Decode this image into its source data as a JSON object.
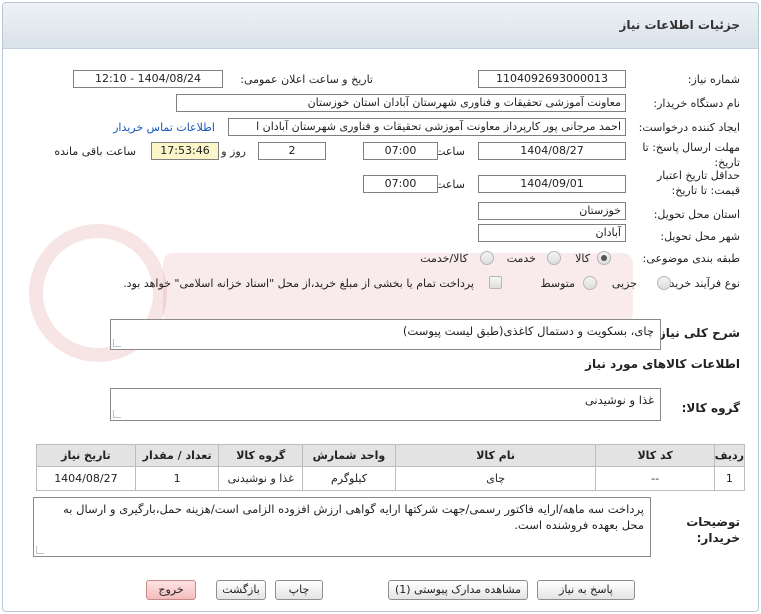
{
  "header": {
    "title": "جزئیات اطلاعات نیاز"
  },
  "fields": {
    "need_number_label": "شماره نیاز:",
    "need_number": "1104092693000013",
    "announce_label": "تاریخ و ساعت اعلان عمومی:",
    "announce_value": "1404/08/24 - 12:10",
    "buyer_org_label": "نام دستگاه خریدار:",
    "buyer_org": "معاونت آموزشی  تحقیقات و فناوری شهرستان آبادان استان خوزستان",
    "requester_label": "ایجاد کننده درخواست:",
    "requester": "احمد  مرجانی پور کارپرداز معاونت آموزشی  تحقیقات و فناوری شهرستان آبادان ا",
    "contact_link": "اطلاعات تماس خریدار",
    "deadline_label": "مهلت ارسال پاسخ: تا تاریخ:",
    "deadline_date": "1404/08/27",
    "time_label": "ساعت",
    "deadline_time": "07:00",
    "days_value": "2",
    "days_label": "روز و",
    "remaining_time": "17:53:46",
    "remaining_label": "ساعت باقی مانده",
    "validity_label": "حداقل تاریخ اعتبار قیمت: تا تاریخ:",
    "validity_date": "1404/09/01",
    "validity_time": "07:00",
    "province_label": "استان محل تحویل:",
    "province": "خوزستان",
    "city_label": "شهر محل تحویل:",
    "city": "آبادان",
    "category_label": "طبقه بندی موضوعی:",
    "category_options": [
      "کالا",
      "خدمت",
      "کالا/خدمت"
    ],
    "category_selected": "کالا",
    "process_label": "نوع فرآیند خرید :",
    "process_options": [
      "جزیی",
      "متوسط"
    ],
    "process_selected": "جزیی",
    "treasury_note": "پرداخت تمام یا بخشی از مبلغ خرید،از محل \"اسناد خزانه اسلامی\" خواهد بود."
  },
  "description": {
    "label": "شرح کلی نیاز:",
    "value": "چای، بسکویت و دستمال کاغذی(طبق لیست پیوست)"
  },
  "goods_section_title": "اطلاعات کالاهای مورد نیاز",
  "goods_group": {
    "label": "گروه کالا:",
    "value": "غذا و نوشیدنی"
  },
  "table": {
    "headers": [
      "ردیف",
      "کد کالا",
      "نام کالا",
      "واحد شمارش",
      "گروه کالا",
      "تعداد / مقدار",
      "تاریخ نیاز"
    ],
    "rows": [
      [
        "1",
        "--",
        "چای",
        "کیلوگرم",
        "غذا و نوشیدنی",
        "1",
        "1404/08/27"
      ]
    ]
  },
  "buyer_notes": {
    "label": "توضیحات خریدار:",
    "value": "پرداخت سه ماهه/ارایه فاکتور رسمی/جهت شرکتها ارایه گواهی ارزش افزوده الزامی است/هزینه حمل،بارگیری و ارسال به محل بعهده فروشنده است."
  },
  "buttons": {
    "reply": "پاسخ به نیاز",
    "attachments": "مشاهده مدارک پیوستی (1)",
    "print": "چاپ",
    "back": "بازگشت",
    "exit": "خروج"
  },
  "colors": {
    "link": "#1a55b8",
    "highlight": "#fbf5c9",
    "exit_button": "#f4bcbc"
  }
}
